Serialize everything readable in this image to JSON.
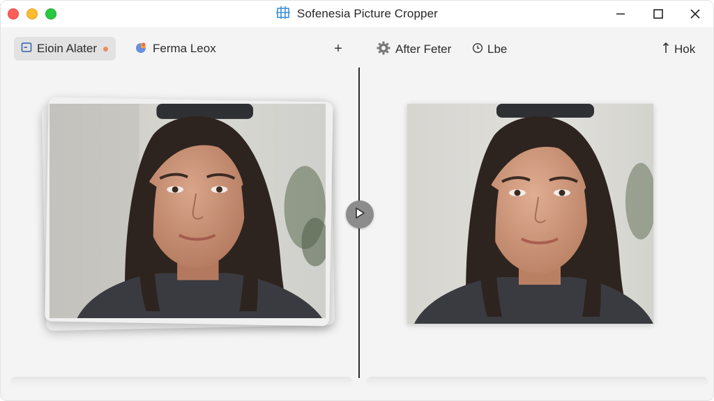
{
  "window": {
    "title": "Sofenesia Picture Cropper",
    "title_icon": "crop-grid-icon"
  },
  "toolbar": {
    "tabs": [
      {
        "label": "Eioin Alater",
        "icon": "frame-icon",
        "active": true,
        "badge": "orange-dot"
      },
      {
        "label": "Ferma Leox",
        "icon": "color-pie-icon",
        "active": false
      }
    ],
    "add_label": "+",
    "right": {
      "after_label": "After Feter",
      "after_icon": "gear-icon",
      "time_label": "Lbe",
      "time_icon": "clock-icon",
      "hok_label": "Hok",
      "hok_icon": "sort-icon"
    }
  },
  "colors": {
    "accent_dot": "#f08a5d",
    "divider": "#2b2b2b",
    "handle": "#8c8c8c"
  },
  "compare": {
    "handle_icon": "play-icon"
  }
}
